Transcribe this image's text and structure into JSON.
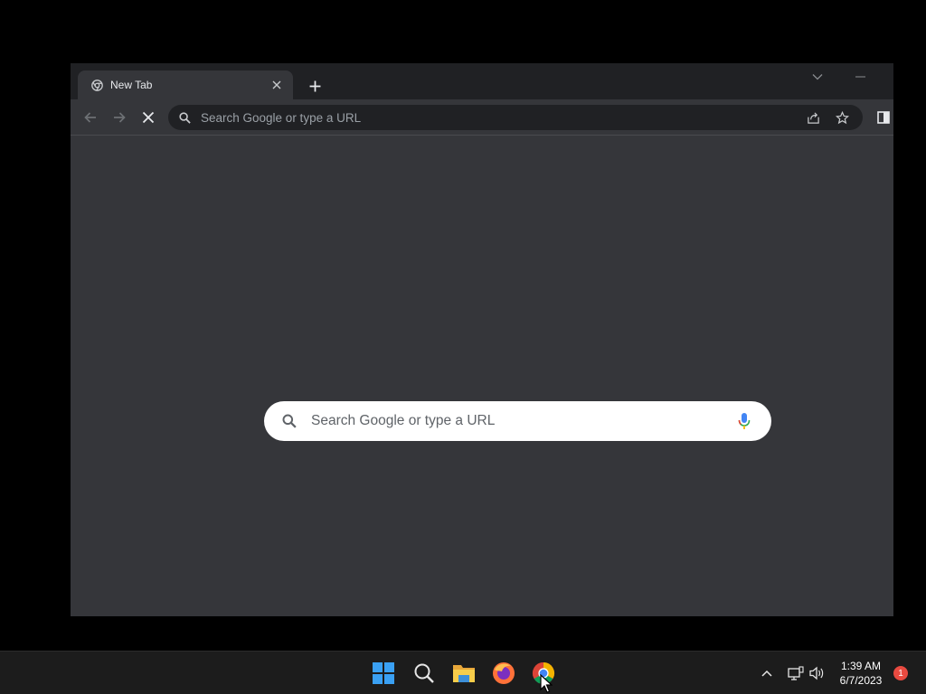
{
  "browser": {
    "tab": {
      "title": "New Tab",
      "favicon": "chrome-icon",
      "close_icon": "close-icon"
    },
    "new_tab_icon": "plus-icon",
    "omnibox": {
      "placeholder": "Search Google or type a URL",
      "value": ""
    },
    "icons": {
      "back": "arrow-left-icon",
      "forward": "arrow-right-icon",
      "stop": "stop-loading-icon",
      "share": "share-icon",
      "bookmark": "star-icon",
      "side_panel": "side-panel-icon",
      "tab_search": "chevron-down-icon",
      "minimize": "minimize-icon"
    }
  },
  "new_tab_page": {
    "search_placeholder": "Search Google or type a URL",
    "mic_icon": "microphone-icon"
  },
  "taskbar": {
    "apps": [
      "windows-start-icon",
      "search-icon",
      "file-explorer-icon",
      "firefox-icon",
      "chrome-icon"
    ],
    "tray": [
      "chevron-up-icon",
      "network-icon",
      "volume-icon"
    ],
    "time": "1:39 AM",
    "date": "6/7/2023",
    "notification_count": "1"
  },
  "colors": {
    "titlebar": "#202124",
    "toolbar": "#35363a",
    "content": "#35363a",
    "omnibox": "#202124",
    "taskbar": "#1c1c1c",
    "badge": "#e84a40"
  }
}
